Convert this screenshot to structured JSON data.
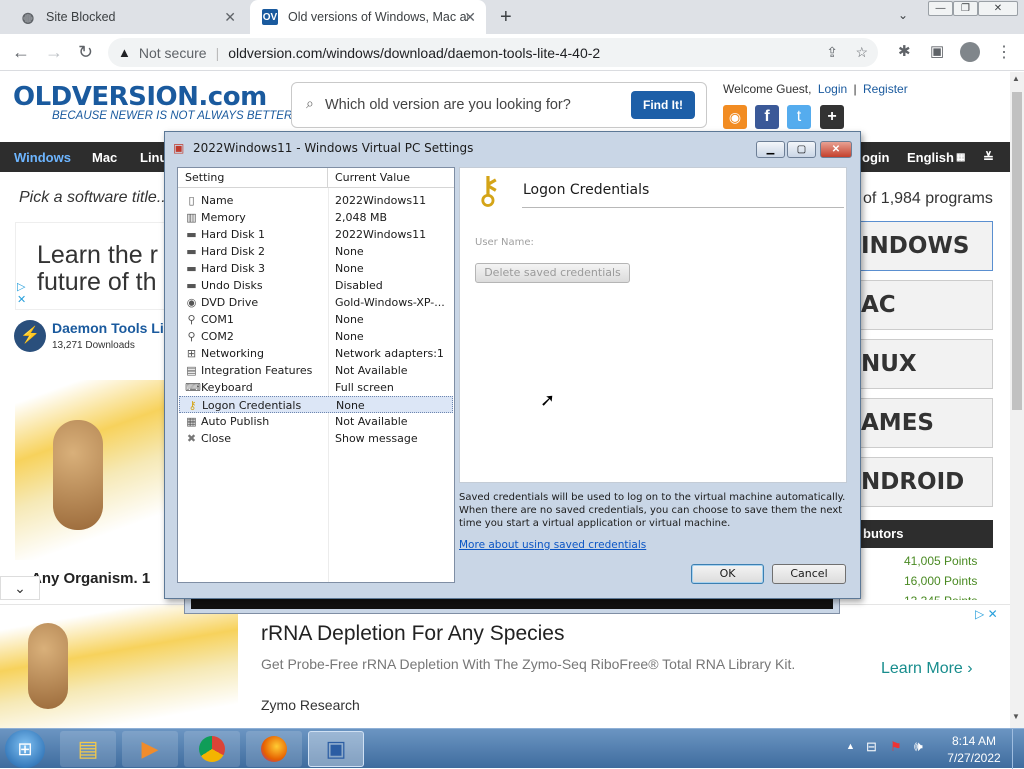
{
  "browser": {
    "tabs": [
      {
        "title": "Site Blocked",
        "active": false
      },
      {
        "title": "Old versions of Windows, Mac ar",
        "active": true
      }
    ],
    "new_tab_glyph": "+",
    "address_security": "Not secure",
    "address_url": "oldversion.com/windows/download/daemon-tools-lite-4-40-2"
  },
  "site": {
    "logo_main": "OLDVERSION.com",
    "logo_tagline": "BECAUSE NEWER IS NOT ALWAYS BETTER!",
    "search_placeholder": "Which old version are you looking for?",
    "search_button": "Find It!",
    "welcome": "Welcome Guest,",
    "login": "Login",
    "separator": "|",
    "register": "Register",
    "nav": {
      "windows": "Windows",
      "mac": "Mac",
      "linux": "Linu",
      "login": "ogin",
      "language": "English"
    },
    "pick_title": "Pick a software title...",
    "programs_count": "of 1,984 programs",
    "ad_line1": "Learn the r",
    "ad_line2": "future of th",
    "app_name": "Daemon Tools Li",
    "app_downloads": "13,271 Downloads",
    "organism_text": "Any Organism. 1",
    "categories": [
      "INDOWS",
      "AC",
      "NUX",
      "AMES",
      "NDROID"
    ],
    "contributors_label": "butors",
    "points": [
      "41,005 Points",
      "16,000 Points",
      "13,345 Points"
    ]
  },
  "ad_bottom": {
    "headline": "rRNA Depletion For Any Species",
    "body": "Get Probe-Free rRNA Depletion With The Zymo-Seq RiboFree® Total RNA Library Kit.",
    "advertiser": "Zymo Research",
    "cta": "Learn More"
  },
  "dialog": {
    "title": "2022Windows11 - Windows Virtual PC Settings",
    "headers": {
      "setting": "Setting",
      "value": "Current Value"
    },
    "settings": [
      {
        "icon": "document-icon",
        "name": "Name",
        "value": "2022Windows11"
      },
      {
        "icon": "memory-icon",
        "name": "Memory",
        "value": "2,048 MB"
      },
      {
        "icon": "hard-disk-icon",
        "name": "Hard Disk 1",
        "value": "2022Windows11"
      },
      {
        "icon": "hard-disk-icon",
        "name": "Hard Disk 2",
        "value": "None"
      },
      {
        "icon": "hard-disk-icon",
        "name": "Hard Disk 3",
        "value": "None"
      },
      {
        "icon": "undo-disk-icon",
        "name": "Undo Disks",
        "value": "Disabled"
      },
      {
        "icon": "dvd-drive-icon",
        "name": "DVD Drive",
        "value": "Gold-Windows-XP-..."
      },
      {
        "icon": "com-port-icon",
        "name": "COM1",
        "value": "None"
      },
      {
        "icon": "com-port-icon",
        "name": "COM2",
        "value": "None"
      },
      {
        "icon": "network-icon",
        "name": "Networking",
        "value": "Network adapters:1"
      },
      {
        "icon": "integration-icon",
        "name": "Integration Features",
        "value": "Not Available"
      },
      {
        "icon": "keyboard-icon",
        "name": "Keyboard",
        "value": "Full screen"
      },
      {
        "icon": "key-icon",
        "name": "Logon Credentials",
        "value": "None",
        "selected": true
      },
      {
        "icon": "publish-icon",
        "name": "Auto Publish",
        "value": "Not Available"
      },
      {
        "icon": "close-x-icon",
        "name": "Close",
        "value": "Show message"
      }
    ],
    "panel_title": "Logon Credentials",
    "username_label": "User Name:",
    "delete_button": "Delete saved credentials",
    "info_text": "Saved credentials will be used to log on to the virtual machine automatically. When there are no saved credentials, you can choose to save them the next time you start a virtual application or virtual machine.",
    "more_link": "More about using saved credentials",
    "ok": "OK",
    "cancel": "Cancel"
  },
  "taskbar": {
    "time": "8:14 AM",
    "date": "7/27/2022",
    "apps": [
      "file-explorer-icon",
      "media-player-icon",
      "chrome-icon",
      "firefox-icon",
      "virtual-pc-icon"
    ]
  },
  "colors": {
    "site_blue": "#1a5a9e",
    "find_button": "#1d5fa8",
    "nav_dark": "#2d2d2d",
    "points_green": "#4a8a23"
  }
}
